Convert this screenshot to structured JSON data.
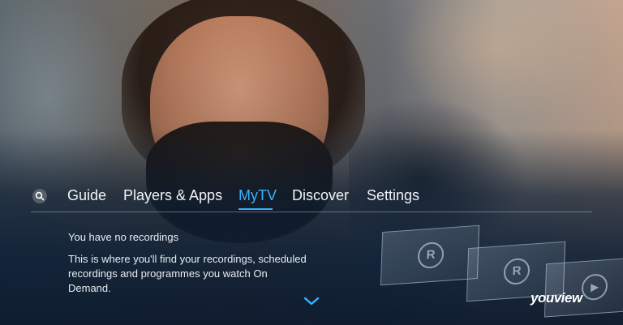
{
  "nav": {
    "items": [
      {
        "label": "Guide",
        "active": false
      },
      {
        "label": "Players & Apps",
        "active": false
      },
      {
        "label": "MyTV",
        "active": true
      },
      {
        "label": "Discover",
        "active": false
      },
      {
        "label": "Settings",
        "active": false
      }
    ]
  },
  "content": {
    "title": "You have no recordings",
    "description": "This is where you'll find your recordings, scheduled recordings and programmes you watch On Demand."
  },
  "brand": {
    "logo_text": "youview"
  },
  "colors": {
    "accent": "#3ab0ff",
    "text": "#f1f4f7"
  },
  "icons": [
    "search-icon",
    "record-icon",
    "play-icon",
    "chevron-down-icon"
  ]
}
